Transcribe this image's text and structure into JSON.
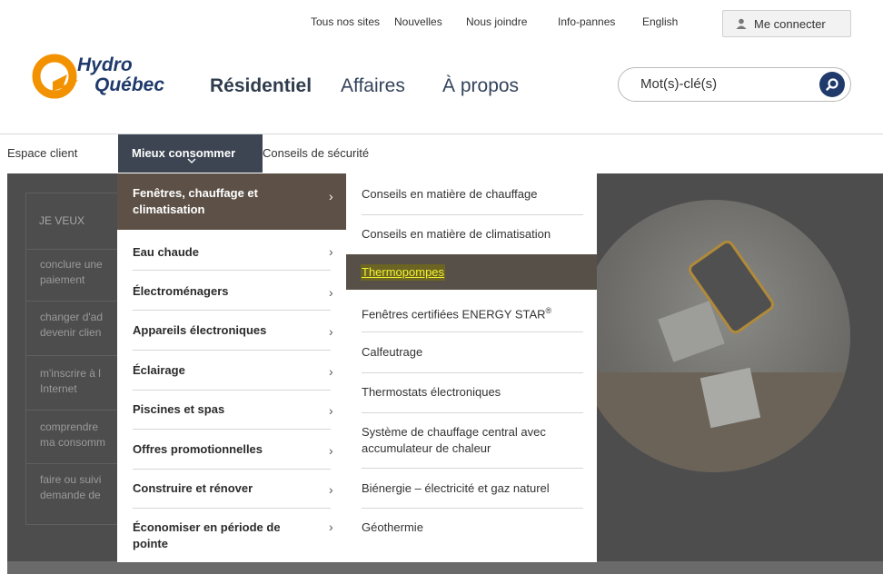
{
  "utility_links": [
    "Tous nos sites",
    "Nouvelles",
    "Nous joindre",
    "Info-pannes",
    "English"
  ],
  "login_label": "Me connecter",
  "logo": {
    "line1": "Hydro",
    "line2": "Québec"
  },
  "main_nav": [
    "Résidentiel",
    "Affaires",
    "À propos"
  ],
  "search_placeholder": "Mot(s)-clé(s)",
  "sub_nav": [
    "Espace client",
    "Mieux consommer",
    "Conseils de sécurité"
  ],
  "i_want": {
    "title": "JE VEUX",
    "items": [
      [
        "conclure une",
        "paiement"
      ],
      [
        "changer d'ad",
        "devenir clien"
      ],
      [
        "m'inscrire à l",
        "Internet"
      ],
      [
        "comprendre",
        "ma consomm"
      ],
      [
        "faire ou suivi",
        "demande de"
      ]
    ]
  },
  "menu_left": [
    {
      "label": [
        "Fenêtres, chauffage et",
        "climatisation"
      ],
      "active": true
    },
    {
      "label": [
        "Eau chaude"
      ]
    },
    {
      "label": [
        "Électroménagers"
      ]
    },
    {
      "label": [
        "Appareils électroniques"
      ]
    },
    {
      "label": [
        "Éclairage"
      ]
    },
    {
      "label": [
        "Piscines et spas"
      ]
    },
    {
      "label": [
        "Offres promotionnelles"
      ]
    },
    {
      "label": [
        "Construire et rénover"
      ]
    },
    {
      "label": [
        "Économiser en période de",
        "pointe"
      ]
    }
  ],
  "menu_right": [
    {
      "label": [
        "Conseils en matière de chauffage"
      ]
    },
    {
      "label": [
        "Conseils en matière de climatisation"
      ]
    },
    {
      "label": [
        "Thermopompes"
      ],
      "active": true
    },
    {
      "label": [
        "Fenêtres certifiées ENERGY STAR"
      ],
      "sup": "®"
    },
    {
      "label": [
        "Calfeutrage"
      ]
    },
    {
      "label": [
        "Thermostats électroniques"
      ]
    },
    {
      "label": [
        "Système de chauffage central avec",
        "accumulateur de chaleur"
      ]
    },
    {
      "label": [
        "Biénergie – électricité et gaz naturel"
      ]
    },
    {
      "label": [
        "Géothermie"
      ]
    }
  ],
  "colors": {
    "brand_blue": "#1f3a6b",
    "brand_orange": "#f39200",
    "active_nav": "#3d4552",
    "menu_active": "#5d5147",
    "highlight": "#f2f230"
  }
}
